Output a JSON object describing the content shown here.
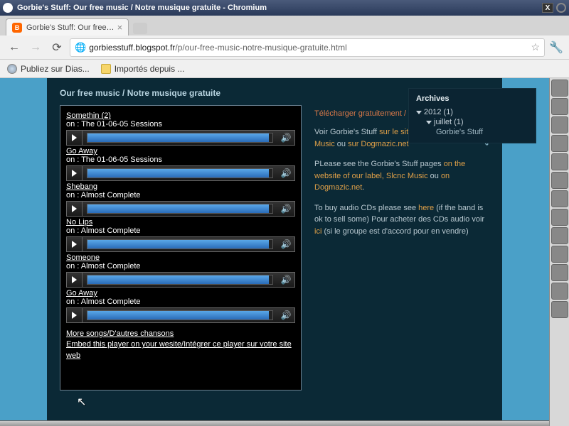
{
  "window": {
    "title": "Gorbie's Stuff: Our free music / Notre musique gratuite - Chromium"
  },
  "tab": {
    "title": "Gorbie's Stuff: Our free…",
    "favicon_letter": "B"
  },
  "url": {
    "host": "gorbiesstuff.blogspot.fr",
    "path": "/p/our-free-music-notre-musique-gratuite.html"
  },
  "bookmarks": [
    {
      "label": "Publiez sur Dias...",
      "icon": "globe"
    },
    {
      "label": "Importés depuis ...",
      "icon": "folder"
    }
  ],
  "page": {
    "title": "Our free music / Notre musique gratuite",
    "tracks": [
      {
        "title": "Somethin (2)",
        "album": "on : The 01-06-05 Sessions"
      },
      {
        "title": "Go Away",
        "album": "on : The 01-06-05 Sessions"
      },
      {
        "title": "Shebang",
        "album": "on : Almost Complete"
      },
      {
        "title": "No Lips",
        "album": "on : Almost Complete"
      },
      {
        "title": "Someone",
        "album": "on : Almost Complete"
      },
      {
        "title": "Go Away",
        "album": "on : Almost Complete"
      }
    ],
    "more_songs": "More songs/D'autres chansons",
    "embed": "Embed this player on your wesite/Intégrer ce player sur votre site web"
  },
  "sidebar": {
    "download_head": "Télécharger gratuitement / Download for free :",
    "p1_pre": "Voir Gorbie's Stuff ",
    "p1_a1": "sur le site de notre label, Slcnc Music",
    "p1_mid": " ou ",
    "p1_a2": "sur Dogmazic.net",
    "p2_pre": "PLease see the Gorbie's Stuff pages ",
    "p2_a1": "on the website of our label, Slcnc Music",
    "p2_mid": " ou ",
    "p2_a2": "on Dogmazic.net",
    "p3_pre": "To buy audio CDs please see ",
    "p3_a1": "here",
    "p3_post": " (if the band is ok to sell some) Pour acheter des CDs audio voir ",
    "p3_a2": "ici",
    "p3_end": " (si le groupe est d'accord pour en vendre)"
  },
  "archives": {
    "title": "Archives",
    "year": "2012 (1)",
    "month": "juillet (1)",
    "post": "Gorbie's Stuff"
  }
}
